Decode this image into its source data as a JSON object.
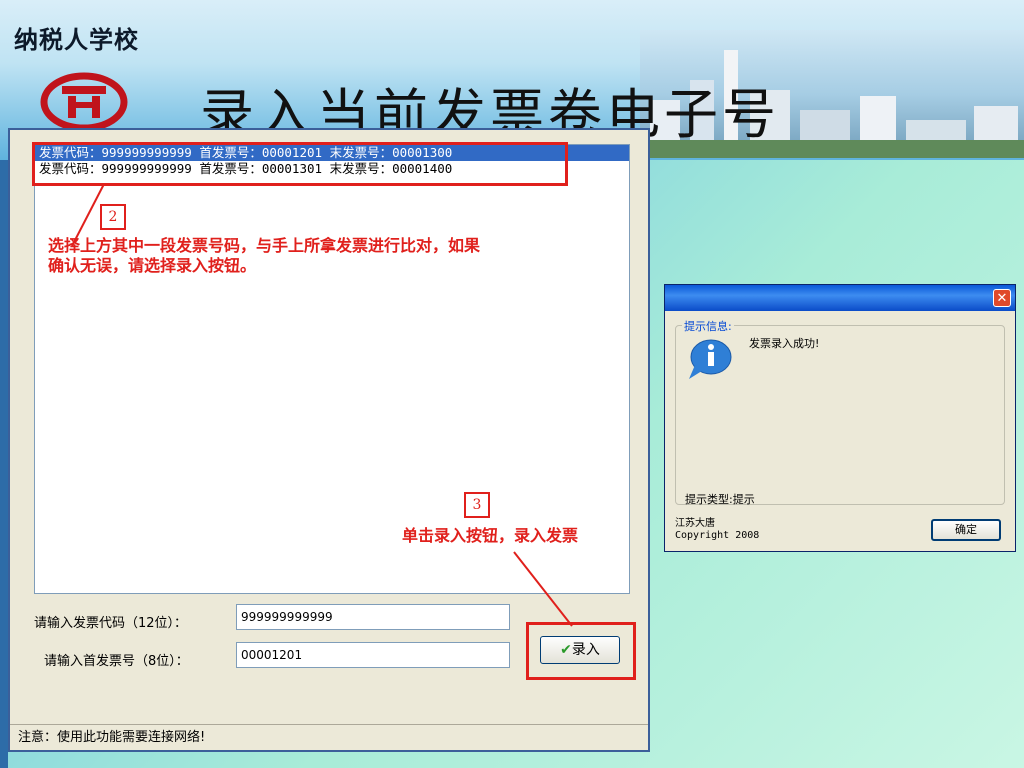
{
  "header": {
    "school_name": "纳税人学校",
    "slide_title": "录入当前发票卷电子号"
  },
  "main_window": {
    "list_rows": [
      "发票代码：999999999999  首发票号：00001201  末发票号：00001300",
      "发票代码：999999999999  首发票号：00001301  末发票号：00001400"
    ],
    "selected_row_index": 0,
    "form": {
      "code_label": "请输入发票代码（12位）：",
      "code_value": "999999999999",
      "first_no_label": "请输入首发票号（8位）：",
      "first_no_value": "00001201",
      "enter_button": "录入"
    },
    "status_text": "注意：使用此功能需要连接网络!"
  },
  "annotations": {
    "step2_number": "2",
    "step2_text_line1": "选择上方其中一段发票号码，与手上所拿发票进行比对，如果",
    "step2_text_line2": "确认无误，请选择录入按钮。",
    "step3_number": "3",
    "step3_text": "单击录入按钮，录入发票",
    "accent_color": "#e0201c"
  },
  "dialog": {
    "group_label": "提示信息:",
    "message": "发票录入成功!",
    "type_text": "提示类型:提示",
    "company": "江苏大唐",
    "copyright": "Copyright 2008",
    "ok_button": "确定",
    "icon": "info-icon"
  }
}
